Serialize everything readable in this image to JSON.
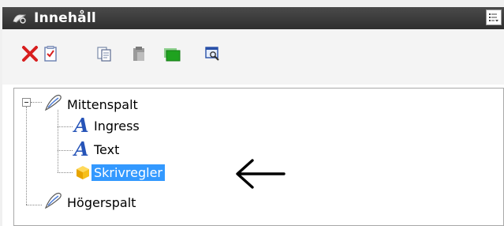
{
  "panel": {
    "title": "Innehåll",
    "title_icon": "content-pen-icon",
    "menu_icon": "list-menu-icon"
  },
  "toolbar": {
    "icons": [
      "delete-icon",
      "checklist-icon",
      "copy-icon",
      "paste-icon",
      "green-block-icon",
      "preview-icon"
    ]
  },
  "tree": {
    "nodes": [
      {
        "label": "Mittenspalt",
        "icon": "pin-icon"
      },
      {
        "label": "Ingress",
        "icon": "text-a-icon"
      },
      {
        "label": "Text",
        "icon": "text-a-icon"
      },
      {
        "label": "Skrivregler",
        "icon": "cube-icon",
        "selected": true
      },
      {
        "label": "Högerspalt",
        "icon": "pin-icon"
      }
    ]
  },
  "annotation": {
    "icon": "left-arrow-icon"
  }
}
